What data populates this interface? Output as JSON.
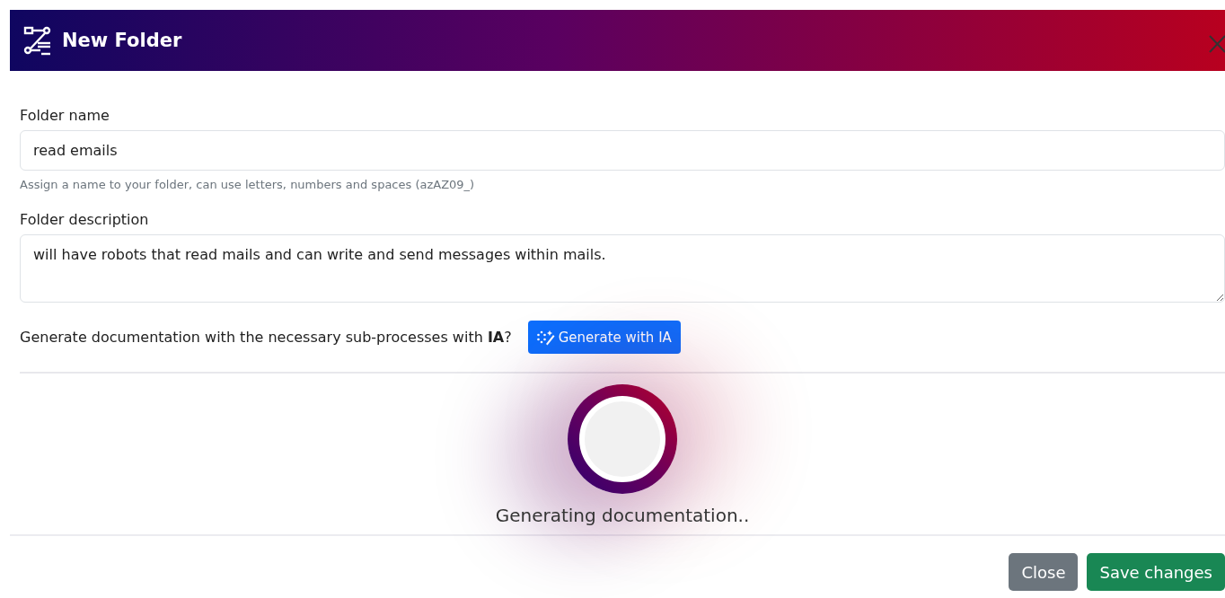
{
  "window": {
    "title": "New Folder"
  },
  "fields": [
    {
      "label": "Folder name",
      "value": "read emails",
      "help": "Assign a name to your folder, can use letters, numbers and spaces (azAZ09_)",
      "kind": "input"
    },
    {
      "label": "Folder description",
      "value": "will have robots that read mails and can write and send messages within mails.",
      "kind": "textarea"
    }
  ],
  "generate": {
    "question": "Generate documentation with the necessary sub-processes with **IA**?",
    "button": "Generate with IA"
  },
  "loader": {
    "message": "Generating documentation.."
  },
  "buttons": [
    {
      "label": "Close",
      "kind": "secondary"
    },
    {
      "label": "Save changes",
      "kind": "primary"
    }
  ]
}
